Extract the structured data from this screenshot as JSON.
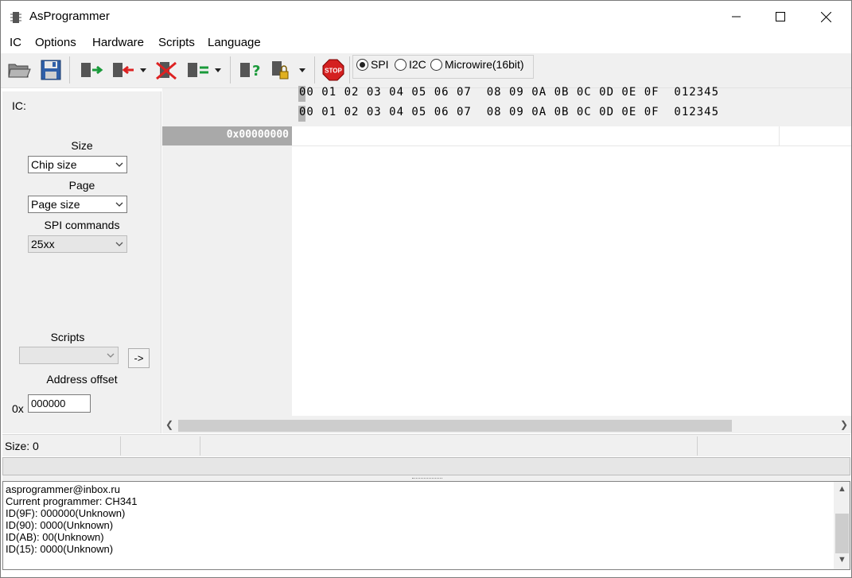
{
  "window": {
    "title": "AsProgrammer"
  },
  "menu": [
    "IC",
    "Options",
    "Hardware",
    "Scripts",
    "Language"
  ],
  "toolbar": {
    "buttons": [
      "open-file",
      "save-file",
      "read",
      "write",
      "erase",
      "verify",
      "read-id",
      "lock",
      "stop"
    ],
    "stop_label": "STOP",
    "protocols": [
      {
        "label": "SPI",
        "selected": true
      },
      {
        "label": "I2C",
        "selected": false
      },
      {
        "label": "Microwire(16bit)",
        "selected": false
      }
    ]
  },
  "left_panel": {
    "ic_label": "IC:",
    "size_label": "Size",
    "size_value": "Chip size",
    "page_label": "Page",
    "page_value": "Page size",
    "spi_commands_label": "SPI commands",
    "spi_commands_value": "25xx",
    "scripts_label": "Scripts",
    "scripts_value": "",
    "scripts_go": "->",
    "address_offset_label": "Address offset",
    "address_prefix": "0x",
    "address_offset_value": "000000"
  },
  "hex": {
    "header_row_1": "00 01 02 03 04 05 06 07  08 09 0A 0B 0C 0D 0E 0F  012345",
    "header_row_2": "00 01 02 03 04 05 06 07  08 09 0A 0B 0C 0D 0E 0F  012345",
    "first_address": "0x00000000"
  },
  "status": {
    "size_text": "Size: 0"
  },
  "log": {
    "lines": [
      "asprogrammer@inbox.ru",
      "Current programmer: CH341",
      "ID(9F): 000000(Unknown)",
      "ID(90): 0000(Unknown)",
      "ID(AB): 00(Unknown)",
      "ID(15): 0000(Unknown)"
    ]
  }
}
